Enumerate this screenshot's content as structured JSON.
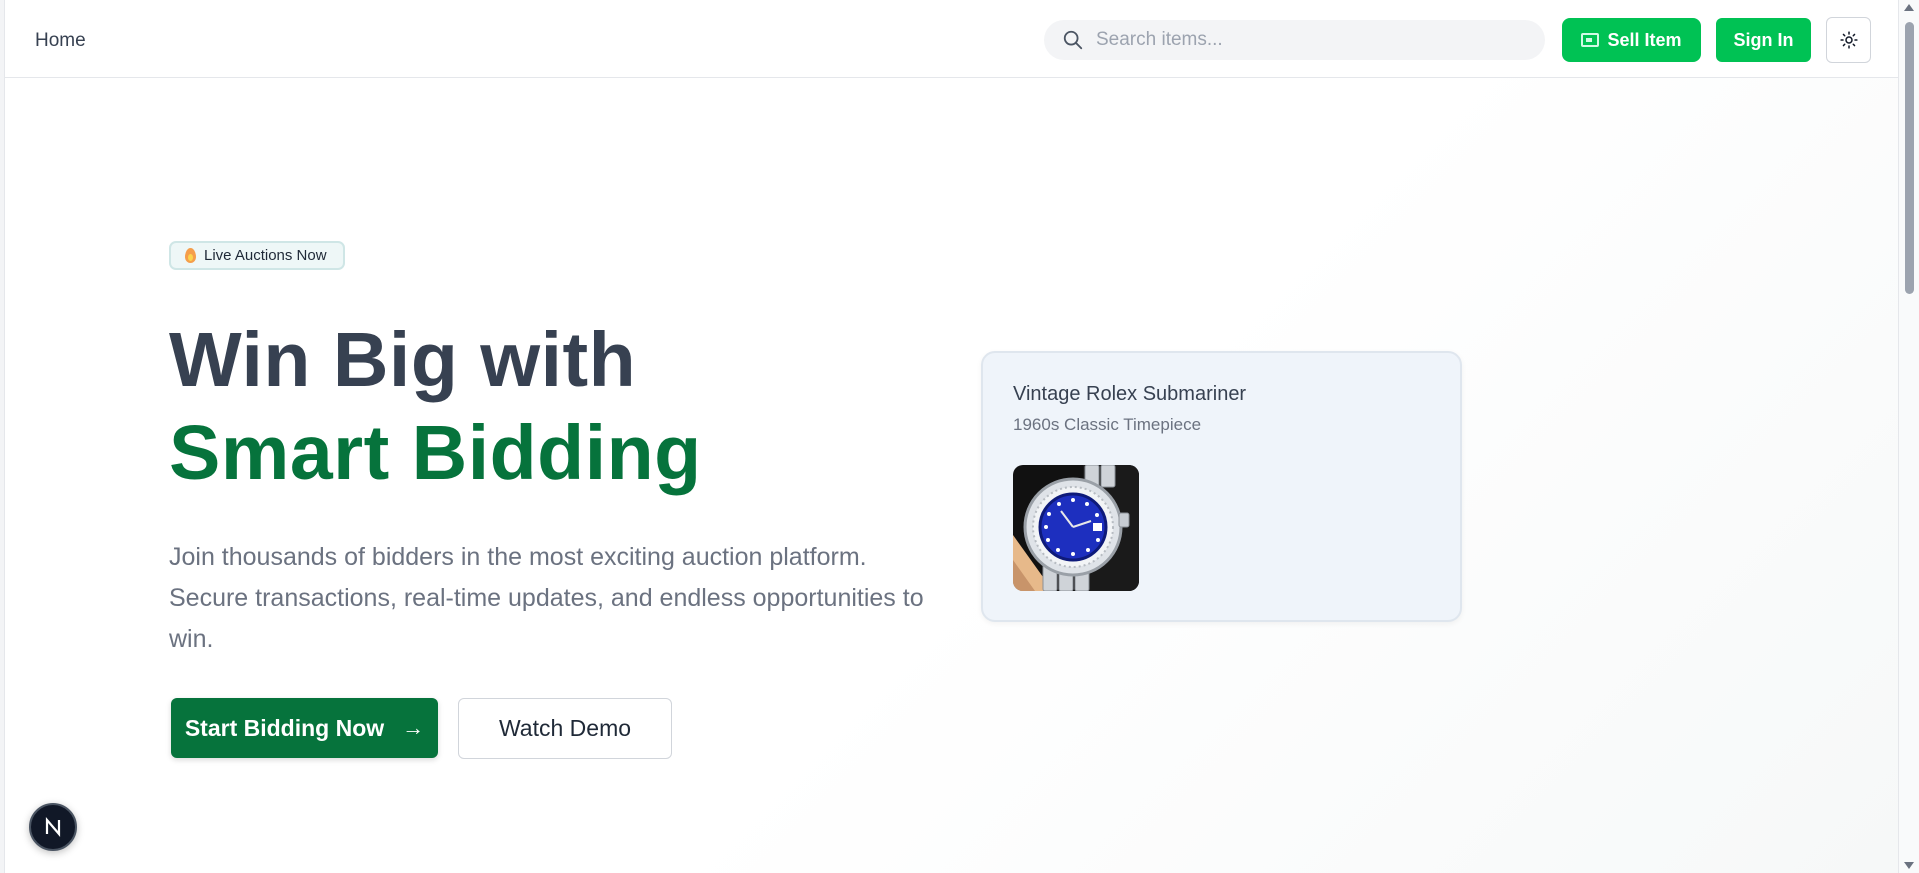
{
  "header": {
    "nav_home": "Home",
    "search_placeholder": "Search items...",
    "sell_label": "Sell Item",
    "signin_label": "Sign In"
  },
  "hero": {
    "badge": "Live Auctions Now",
    "headline_line1": "Win Big with",
    "headline_line2": "Smart Bidding",
    "subtext": "Join thousands of bidders in the most exciting auction platform. Secure transactions, real-time updates, and endless opportunities to win.",
    "primary_cta": "Start Bidding Now",
    "secondary_cta": "Watch Demo"
  },
  "card": {
    "title": "Vintage Rolex Submariner",
    "subtitle": "1960s Classic Timepiece"
  },
  "colors": {
    "brand_green": "#00c254",
    "dark_green": "#06733c",
    "text_dark": "#374151",
    "text_muted": "#6b7280"
  },
  "icons": [
    "search-icon",
    "sell-icon",
    "sun-icon",
    "fire-icon",
    "arrow-right-icon",
    "next-logo-icon"
  ]
}
